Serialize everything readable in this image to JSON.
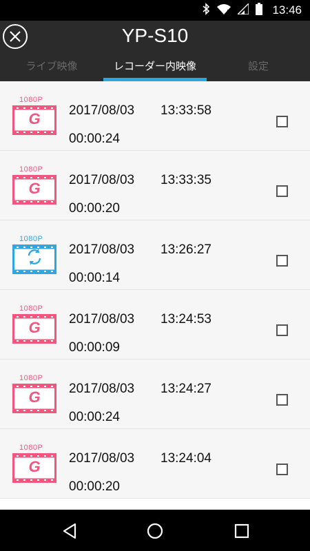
{
  "status_bar": {
    "time": "13:46",
    "icons": [
      "bluetooth-icon",
      "wifi-icon",
      "signal-icon",
      "battery-icon"
    ]
  },
  "header": {
    "title": "YP-S10",
    "close_icon": "close-icon",
    "tabs": [
      {
        "label": "ライブ映像",
        "active": false
      },
      {
        "label": "レコーダー内映像",
        "active": true
      },
      {
        "label": "設定",
        "active": false
      }
    ],
    "accent_color": "#2ba7e0"
  },
  "recordings": [
    {
      "resolution": "1080P",
      "type": "g-sensor",
      "date": "2017/08/03",
      "time": "13:33:58",
      "duration": "00:00:24",
      "checked": false
    },
    {
      "resolution": "1080P",
      "type": "g-sensor",
      "date": "2017/08/03",
      "time": "13:33:35",
      "duration": "00:00:20",
      "checked": false
    },
    {
      "resolution": "1080P",
      "type": "loop",
      "date": "2017/08/03",
      "time": "13:26:27",
      "duration": "00:00:14",
      "checked": false
    },
    {
      "resolution": "1080P",
      "type": "g-sensor",
      "date": "2017/08/03",
      "time": "13:24:53",
      "duration": "00:00:09",
      "checked": false
    },
    {
      "resolution": "1080P",
      "type": "g-sensor",
      "date": "2017/08/03",
      "time": "13:24:27",
      "duration": "00:00:24",
      "checked": false
    },
    {
      "resolution": "1080P",
      "type": "g-sensor",
      "date": "2017/08/03",
      "time": "13:24:04",
      "duration": "00:00:20",
      "checked": false
    }
  ],
  "colors": {
    "g_sensor": "#f2557e",
    "loop": "#2ea6e3"
  },
  "nav_bar": {
    "icons": [
      "back-icon",
      "home-icon",
      "recents-icon"
    ]
  }
}
